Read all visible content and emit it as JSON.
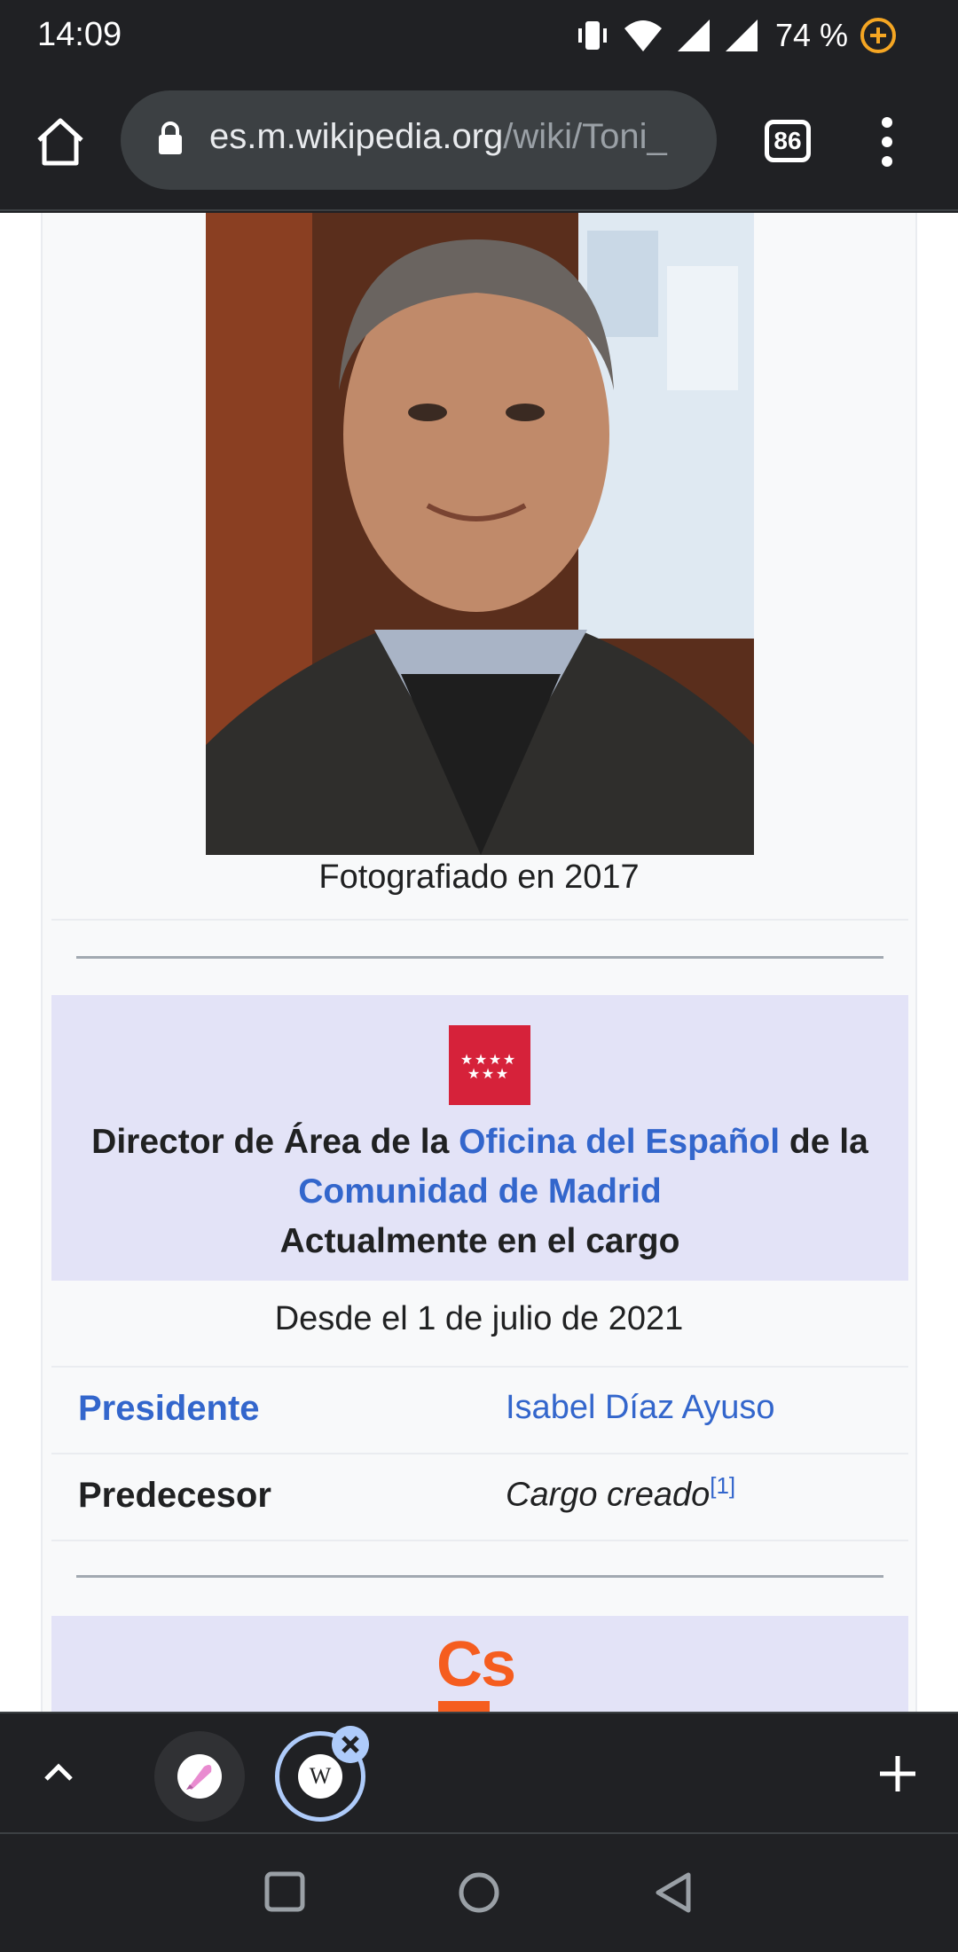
{
  "status_bar": {
    "time": "14:09",
    "battery": "74 %",
    "icons": [
      "vibrate-icon",
      "wifi-icon",
      "signal-icon",
      "signal-icon",
      "battery-saver-icon"
    ]
  },
  "browser": {
    "url_host": "es.m.wikipedia.org",
    "url_path": "/wiki/Toni_",
    "tab_count": "86"
  },
  "infobox": {
    "photo_caption": "Fotografiado en 2017",
    "office": {
      "title_part1": "Director de Área de la ",
      "link1": "Oficina del Español",
      "title_part2": " de la ",
      "link2": "Comunidad de Madrid",
      "status": "Actualmente en el cargo",
      "since": "Desde el 1 de julio de 2021"
    },
    "rows": [
      {
        "label": "Presidente",
        "value": "Isabel Díaz Ayuso"
      },
      {
        "label": "Predecesor",
        "value": "Cargo creado",
        "ref": "[1]"
      }
    ],
    "party_logo": "Cs"
  },
  "colors": {
    "link": "#3366cc",
    "office_header_bg": "#e3e3f7",
    "flag_red": "#d6223a",
    "cs_orange": "#f55d1f",
    "toolbar_bg": "#202124"
  }
}
